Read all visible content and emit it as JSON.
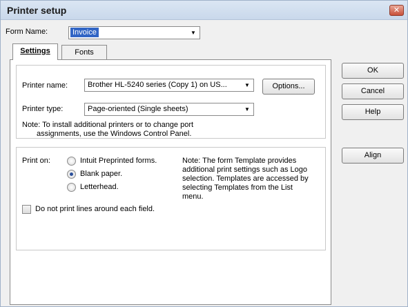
{
  "window": {
    "title": "Printer setup",
    "close_glyph": "✕"
  },
  "form_name": {
    "label": "Form Name:",
    "value": "Invoice"
  },
  "tabs": [
    {
      "label": "Settings",
      "active": true
    },
    {
      "label": "Fonts",
      "active": false
    }
  ],
  "printer": {
    "name_label": "Printer name:",
    "name_value": "Brother HL-5240 series (Copy 1) on US...",
    "options_button": "Options...",
    "type_label": "Printer type:",
    "type_value": "Page-oriented (Single sheets)",
    "note_line1": "Note: To install additional printers or to change port",
    "note_line2": "assignments, use the Windows Control Panel."
  },
  "print_on": {
    "label": "Print on:",
    "options": [
      {
        "label": "Intuit Preprinted forms.",
        "checked": false
      },
      {
        "label": "Blank paper.",
        "checked": true
      },
      {
        "label": "Letterhead.",
        "checked": false
      }
    ],
    "note_lines": [
      "Note: The form Template provides",
      "additional print settings such as Logo",
      "selection.  Templates are accessed by",
      "selecting Templates from the List",
      "menu."
    ],
    "no_lines_checkbox": "Do not print lines around each field."
  },
  "buttons": {
    "ok": "OK",
    "cancel": "Cancel",
    "help": "Help",
    "align": "Align"
  },
  "icons": {
    "dropdown": "chevron-down-icon",
    "close": "close-icon"
  },
  "colors": {
    "selection": "#3165c5",
    "titlebar": "#c9d8eb",
    "close": "#c8503a"
  }
}
